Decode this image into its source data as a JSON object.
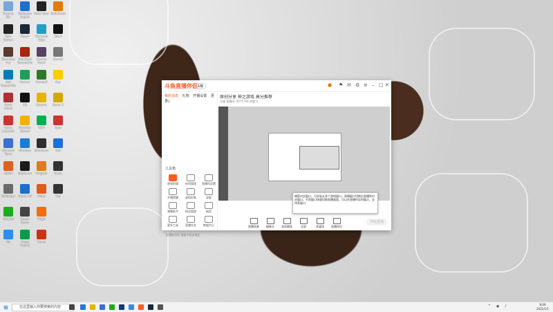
{
  "desktop_icons": [
    {
      "label": "Recycle Bin",
      "color": "#7aa6d9"
    },
    {
      "label": "Epic Games Launcher",
      "color": "#222"
    },
    {
      "label": "Devil May Cry",
      "color": "#5a3a2a"
    },
    {
      "label": "Dell SupportAssist",
      "color": "#007db8"
    },
    {
      "label": "Dead Island",
      "color": "#a33"
    },
    {
      "label": "Game Launcher",
      "color": "#c33"
    },
    {
      "label": "Microsoft Store",
      "color": "#3b6fd1"
    },
    {
      "label": "Adobe",
      "color": "#e0601e"
    },
    {
      "label": "Wallpaper",
      "color": "#6a6a6a"
    },
    {
      "label": "WeChat",
      "color": "#1aad19"
    },
    {
      "label": "Bot",
      "color": "#2b8ef0"
    },
    {
      "label": "Wallpaper Engine",
      "color": "#1f6fd1"
    },
    {
      "label": "Steam",
      "color": "#1b2838"
    },
    {
      "label": "Red Dead Redemption",
      "color": "#a21"
    },
    {
      "label": "WeCom",
      "color": "#1e9e5a"
    },
    {
      "label": "QQ",
      "color": "#111"
    },
    {
      "label": "Rockstar Games",
      "color": "#f0b400"
    },
    {
      "label": "Windows",
      "color": "#1c7bd8"
    },
    {
      "label": "Battle.net",
      "color": "#1b1b1b"
    },
    {
      "label": "Steam VR",
      "color": "#1d6fc9"
    },
    {
      "label": "Steam Game",
      "color": "#444"
    },
    {
      "label": "Cheat Engine",
      "color": "#0b9a4a"
    },
    {
      "label": "Metal Gear",
      "color": "#222"
    },
    {
      "label": "Microsoft Edge",
      "color": "#1fa0c9"
    },
    {
      "label": "Control Panel",
      "color": "#546"
    },
    {
      "label": "Uninstall",
      "color": "#2a7a2a"
    },
    {
      "label": "Chrome",
      "color": "#e8b400"
    },
    {
      "label": "iQIYI",
      "color": "#00b050"
    },
    {
      "label": "Bandicam",
      "color": "#2e2e2e"
    },
    {
      "label": "Kingsoft",
      "color": "#e4791b"
    },
    {
      "label": "Video",
      "color": "#e05a1a"
    },
    {
      "label": "Origin",
      "color": "#f56c0a"
    },
    {
      "label": "Game",
      "color": "#c31"
    },
    {
      "label": "BaiduNetdisk",
      "color": "#e37b0c"
    },
    {
      "label": "Black",
      "color": "#111"
    },
    {
      "label": "Game2",
      "color": "#777"
    },
    {
      "label": "Star",
      "color": "#ffcc00"
    },
    {
      "label": "Game 3",
      "color": "#d4a800"
    },
    {
      "label": "Apex",
      "color": "#c33"
    },
    {
      "label": "Soft",
      "color": "#1e6fd9"
    },
    {
      "label": "Music",
      "color": "#333"
    },
    {
      "label": "Tool",
      "color": "#333"
    }
  ],
  "app": {
    "logo": "斗鱼直播伴侣",
    "level_badge": "1级",
    "tabs": [
      "我的消息",
      "礼物",
      "开播设置",
      "更多"
    ],
    "active_tab": "我的消息",
    "filter_label": "全部",
    "tools_title": "工具箱",
    "tools": [
      {
        "label": "视频剪辑",
        "hot": true
      },
      {
        "label": "房间管理",
        "hot": false
      },
      {
        "label": "直播间设置",
        "hot": false
      },
      {
        "label": "开播提醒",
        "hot": false
      },
      {
        "label": "虚拟形象",
        "hot": false
      },
      {
        "label": "录屏",
        "hot": false
      },
      {
        "label": "弹幕助手",
        "hot": false
      },
      {
        "label": "粉丝管理",
        "hot": false
      },
      {
        "label": "抽奖",
        "hot": false
      },
      {
        "label": "更多工具",
        "hot": false
      },
      {
        "label": "直播任务",
        "hot": false
      },
      {
        "label": "数据中心",
        "hot": false
      }
    ],
    "room_title": "原创分享 神之游戏 高分推荐",
    "room_meta": "主播 直播间: 9075706  热度 0",
    "bottom_buttons": [
      "直播场景",
      "摄像头",
      "游戏捕获",
      "全屏",
      "多媒体",
      "直播伴侣"
    ],
    "go_live": "开始直播",
    "bottom_note": "直播有风险 请遵守相关规定",
    "tooltip": "捕获对应窗口，可实现从多个游戏窗口，直播窗口切换后直播到对应窗口，不同窗口快速切换直播画面，可以在直播时实时展示，支持多窗口"
  },
  "taskbar": {
    "search_placeholder": "在这里输入你要搜索的内容",
    "time": "8:09",
    "date": "2022/1/1"
  }
}
